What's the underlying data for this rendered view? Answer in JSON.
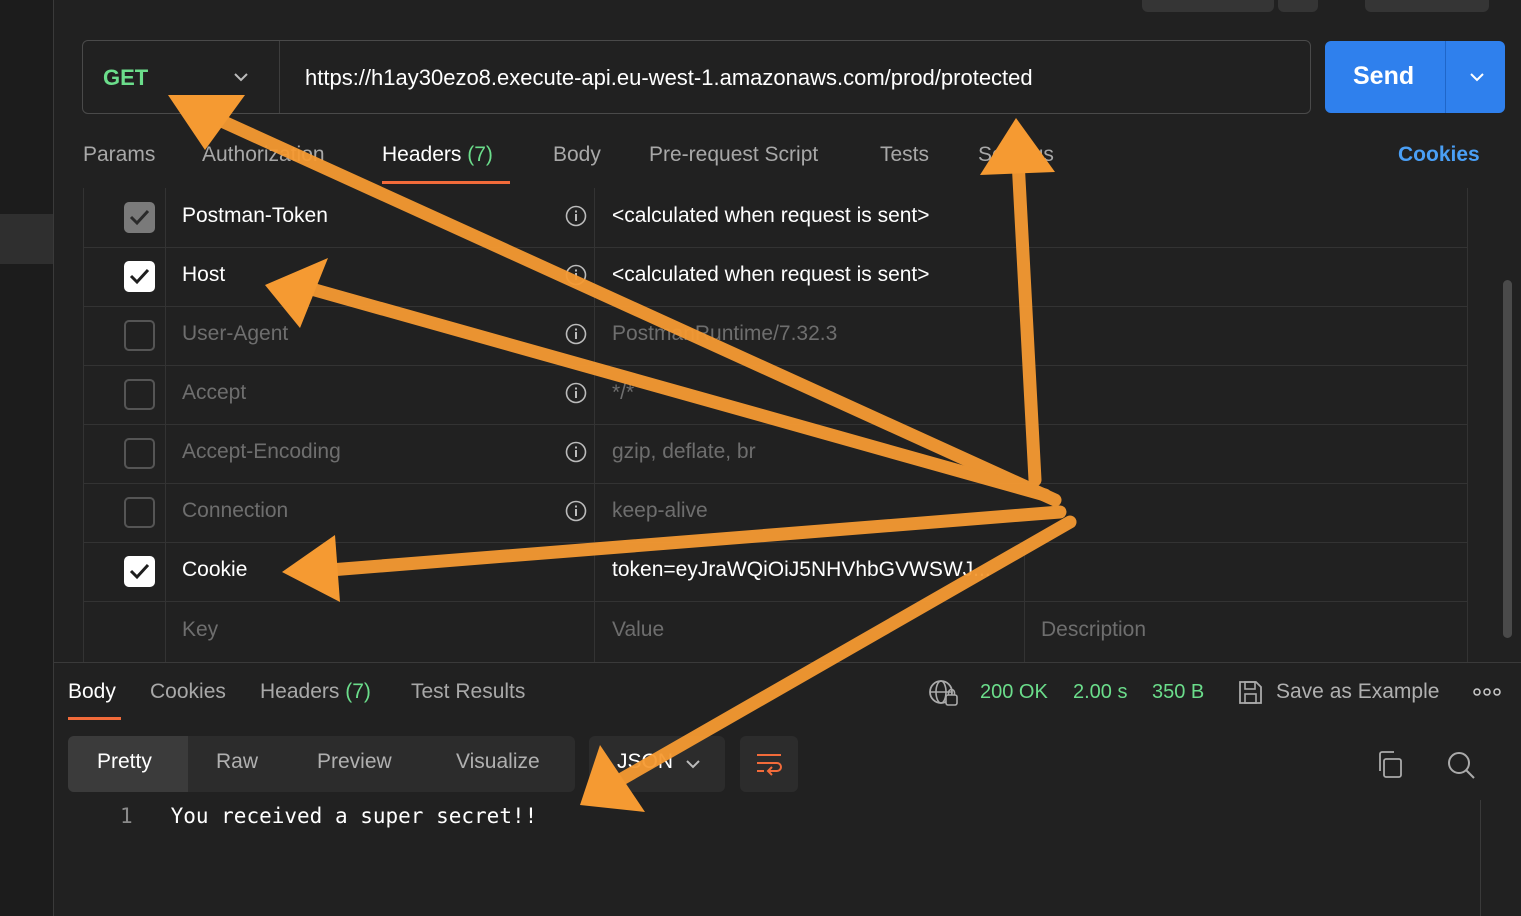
{
  "request": {
    "method": "GET",
    "url": "https://h1ay30ezo8.execute-api.eu-west-1.amazonaws.com/prod/protected",
    "send_label": "Send"
  },
  "tabs": [
    {
      "label": "Params"
    },
    {
      "label": "Authorization"
    },
    {
      "label": "Headers",
      "count": "(7)"
    },
    {
      "label": "Body"
    },
    {
      "label": "Pre-request Script"
    },
    {
      "label": "Tests"
    },
    {
      "label": "Settings"
    }
  ],
  "cookies_link": "Cookies",
  "headers": [
    {
      "key": "Postman-Token",
      "value": "<calculated when request is sent>",
      "checked": "locked"
    },
    {
      "key": "Host",
      "value": "<calculated when request is sent>",
      "checked": "true"
    },
    {
      "key": "User-Agent",
      "value": "PostmanRuntime/7.32.3",
      "checked": "false"
    },
    {
      "key": "Accept",
      "value": "*/*",
      "checked": "false"
    },
    {
      "key": "Accept-Encoding",
      "value": "gzip, deflate, br",
      "checked": "false"
    },
    {
      "key": "Connection",
      "value": "keep-alive",
      "checked": "false"
    },
    {
      "key": "Cookie",
      "value": "token=eyJraWQiOiJ5NHVhbGVWSWJ...",
      "checked": "true"
    }
  ],
  "new_row": {
    "key_placeholder": "Key",
    "value_placeholder": "Value",
    "description_placeholder": "Description"
  },
  "response": {
    "tabs": [
      {
        "label": "Body"
      },
      {
        "label": "Cookies"
      },
      {
        "label": "Headers",
        "count": "(7)"
      },
      {
        "label": "Test Results"
      }
    ],
    "status": "200 OK",
    "time": "2.00 s",
    "size": "350 B",
    "save_example": "Save as Example",
    "view_modes": [
      "Pretty",
      "Raw",
      "Preview",
      "Visualize"
    ],
    "format": "JSON",
    "line_number": "1",
    "body_text": "You received a super secret!!"
  },
  "colors": {
    "accent": "#f26b3a",
    "send": "#2f80ed",
    "success": "#6bdd8b",
    "annotation_arrows": "#f59a32"
  }
}
